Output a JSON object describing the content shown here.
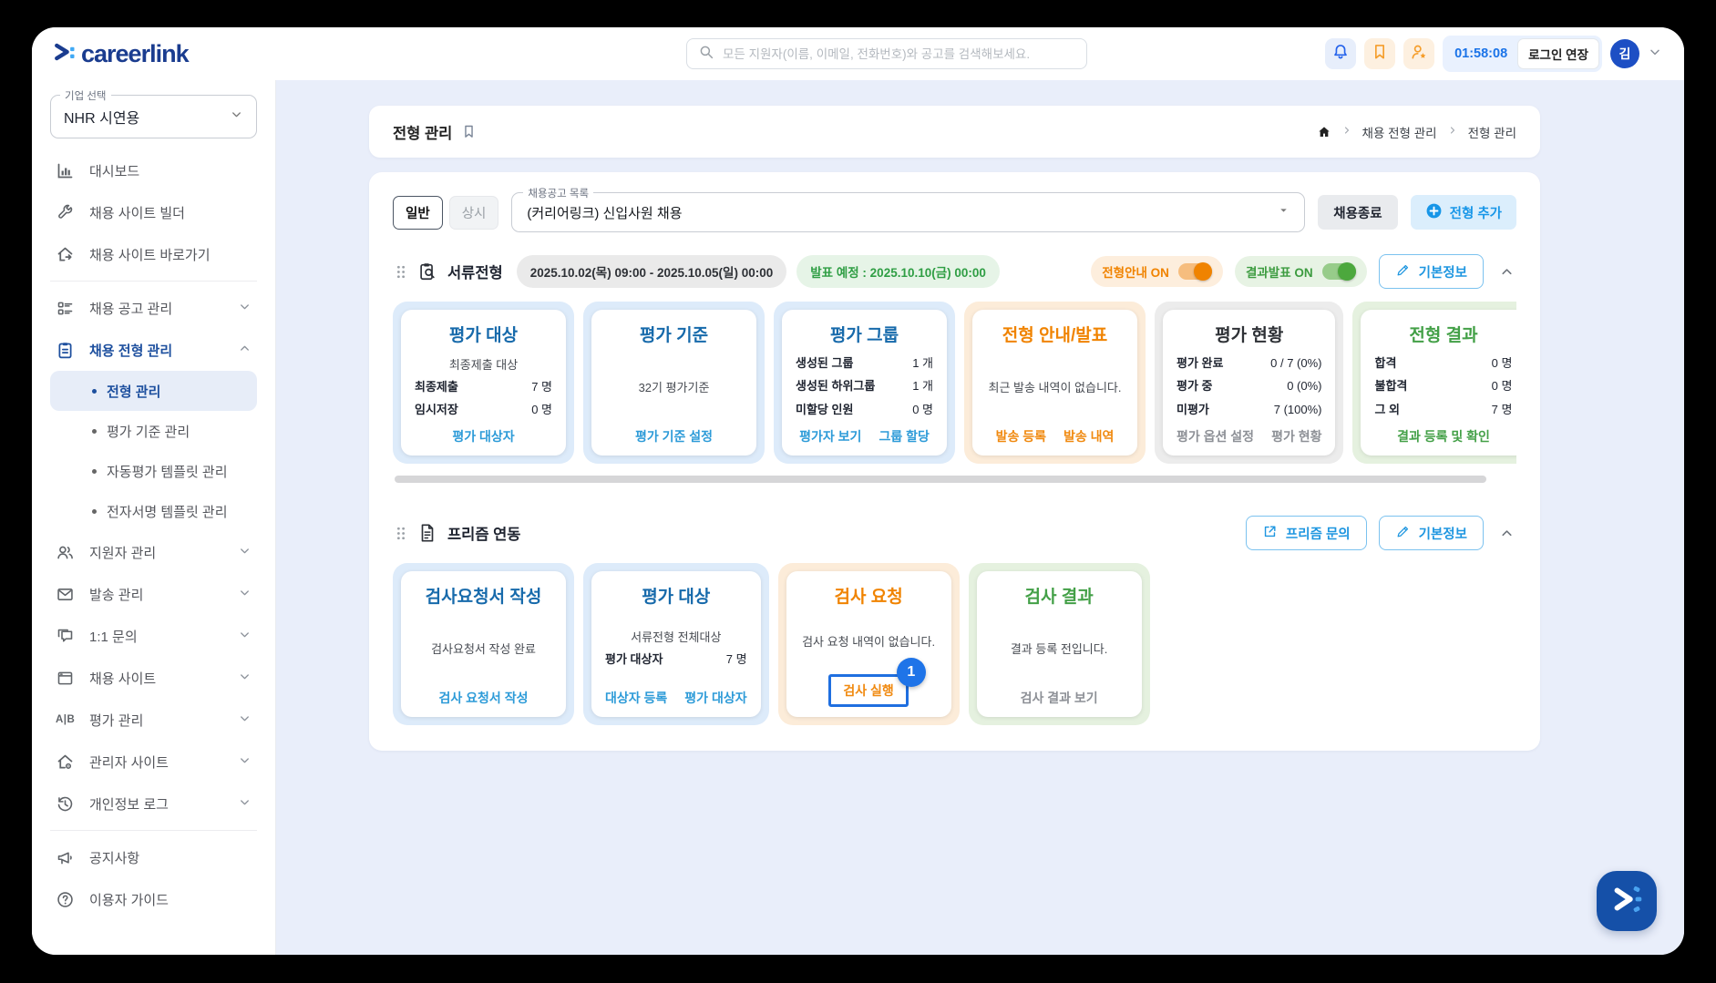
{
  "brand": {
    "logo_text": "careerlink"
  },
  "header": {
    "search_placeholder": "모든 지원자(이름, 이메일, 전화번호)와 공고를 검색해보세요.",
    "session_time": "01:58:08",
    "extend_login_label": "로그인 연장",
    "avatar_initial": "김"
  },
  "sidebar": {
    "company_select": {
      "label": "기업 선택",
      "value": "NHR 시연용"
    },
    "items": [
      {
        "label": "대시보드"
      },
      {
        "label": "채용 사이트 빌더"
      },
      {
        "label": "채용 사이트 바로가기"
      },
      {
        "label": "채용 공고 관리"
      },
      {
        "label": "채용 전형 관리"
      },
      {
        "label": "지원자 관리"
      },
      {
        "label": "발송 관리"
      },
      {
        "label": "1:1 문의"
      },
      {
        "label": "채용 사이트"
      },
      {
        "label": "평가 관리"
      },
      {
        "label": "관리자 사이트"
      },
      {
        "label": "개인정보 로그"
      },
      {
        "label": "공지사항"
      },
      {
        "label": "이용자 가이드"
      }
    ],
    "submenu": [
      {
        "label": "전형 관리"
      },
      {
        "label": "평가 기준 관리"
      },
      {
        "label": "자동평가 템플릿 관리"
      },
      {
        "label": "전자서명 템플릿 관리"
      }
    ]
  },
  "icons": {
    "ab_glyph": "A|B"
  },
  "page": {
    "title": "전형 관리",
    "breadcrumb": [
      "채용 전형 관리",
      "전형 관리"
    ]
  },
  "toolbar": {
    "tabs": [
      {
        "label": "일반"
      },
      {
        "label": "상시"
      }
    ],
    "posting_select": {
      "label": "채용공고 목록",
      "value": "(커리어링크) 신입사원 채용"
    },
    "close_button": "채용종료",
    "add_button": "전형 추가"
  },
  "section1": {
    "title": "서류전형",
    "period": "2025.10.02(목) 09:00 - 2025.10.05(일) 00:00",
    "announce": "발표 예정 : 2025.10.10(금) 00:00",
    "toggle_guide": "전형안내 ON",
    "toggle_result": "결과발표 ON",
    "info_button": "기본정보",
    "cards": [
      {
        "title": "평가 대상",
        "note": "최종제출 대상",
        "rows": [
          {
            "label": "최종제출",
            "value": "7 명"
          },
          {
            "label": "임시저장",
            "value": "0 명"
          }
        ],
        "links": [
          {
            "label": "평가 대상자"
          }
        ]
      },
      {
        "title": "평가 기준",
        "note": "32기 평가기준",
        "links": [
          {
            "label": "평가 기준 설정"
          }
        ]
      },
      {
        "title": "평가 그룹",
        "rows": [
          {
            "label": "생성된 그룹",
            "value": "1 개"
          },
          {
            "label": "생성된 하위그룹",
            "value": "1 개"
          },
          {
            "label": "미할당 인원",
            "value": "0 명"
          }
        ],
        "links": [
          {
            "label": "평가자 보기"
          },
          {
            "label": "그룹 할당"
          }
        ]
      },
      {
        "title": "전형 안내/발표",
        "note": "최근 발송 내역이 없습니다.",
        "links": [
          {
            "label": "발송 등록"
          },
          {
            "label": "발송 내역"
          }
        ]
      },
      {
        "title": "평가 현황",
        "rows": [
          {
            "label": "평가 완료",
            "value": "0 / 7 (0%)"
          },
          {
            "label": "평가 중",
            "value": "0 (0%)"
          },
          {
            "label": "미평가",
            "value": "7 (100%)"
          }
        ],
        "links": [
          {
            "label": "평가 옵션 설정"
          },
          {
            "label": "평가 현황"
          }
        ]
      },
      {
        "title": "전형 결과",
        "rows": [
          {
            "label": "합격",
            "value": "0 명"
          },
          {
            "label": "불합격",
            "value": "0 명"
          },
          {
            "label": "그 외",
            "value": "7 명"
          }
        ],
        "links": [
          {
            "label": "결과 등록 및 확인"
          }
        ]
      }
    ]
  },
  "section2": {
    "title": "프리즘 연동",
    "inquiry_button": "프리즘 문의",
    "info_button": "기본정보",
    "cards": [
      {
        "title": "검사요청서 작성",
        "note": "검사요청서 작성 완료",
        "links": [
          {
            "label": "검사 요청서 작성"
          }
        ]
      },
      {
        "title": "평가 대상",
        "note": "서류전형 전체대상",
        "rows": [
          {
            "label": "평가 대상자",
            "value": "7 명"
          }
        ],
        "links": [
          {
            "label": "대상자 등록"
          },
          {
            "label": "평가 대상자"
          }
        ]
      },
      {
        "title": "검사 요청",
        "note": "검사 요청 내역이 없습니다.",
        "links": [
          {
            "label": "검사 실행"
          }
        ]
      },
      {
        "title": "검사 결과",
        "note": "결과 등록 전입니다.",
        "links": [
          {
            "label": "검사 결과 보기"
          }
        ]
      }
    ]
  },
  "annotation": {
    "step": "1"
  },
  "colors": {
    "brand_navy": "#1a3c8f",
    "brand_light_blue": "#3fa9f5",
    "card_title_blue": "#176aab",
    "link_blue": "#2d9bd8",
    "accent_orange": "#f08300",
    "accent_green": "#43a047",
    "main_bg": "#e9eefa",
    "annotation_blue": "#1f74e8"
  }
}
